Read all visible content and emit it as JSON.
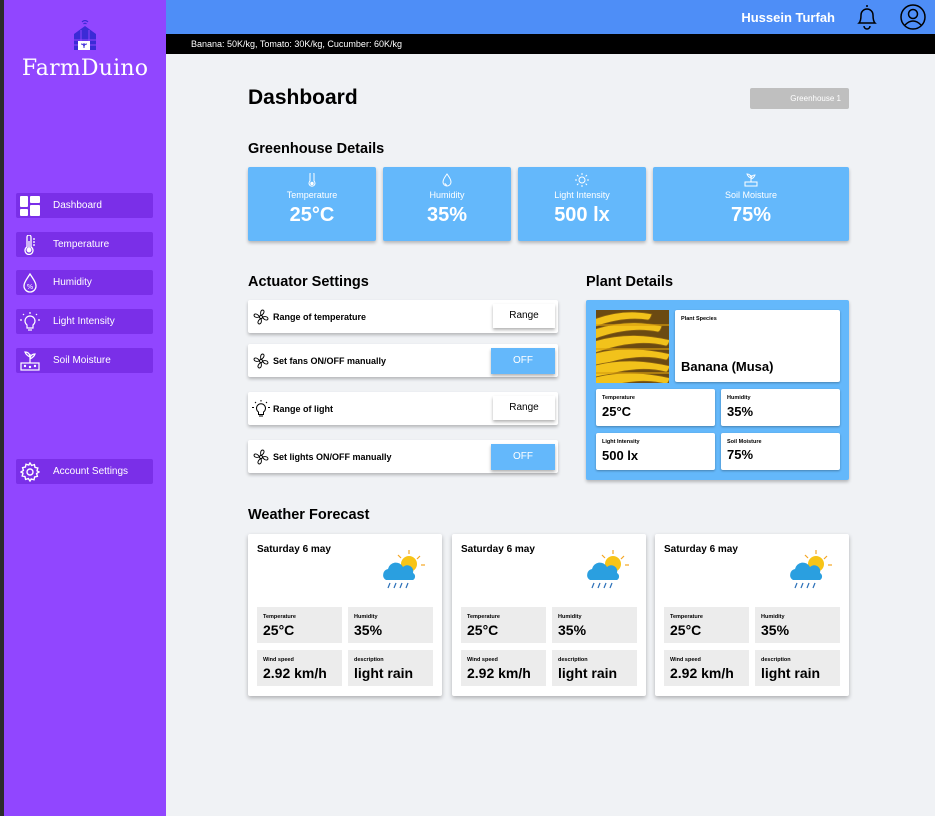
{
  "app": {
    "name": "FarmDuino"
  },
  "header": {
    "user_name": "Hussein Turfah"
  },
  "ticker": "Banana: 50K/kg, Tomato: 30K/kg, Cucumber: 60K/kg",
  "sidebar": {
    "items": [
      {
        "label": "Dashboard",
        "icon": "dashboard-icon"
      },
      {
        "label": "Temperature",
        "icon": "thermometer-icon"
      },
      {
        "label": "Humidity",
        "icon": "humidity-icon"
      },
      {
        "label": "Light Intensity",
        "icon": "lightbulb-icon"
      },
      {
        "label": "Soil Moisture",
        "icon": "soil-moisture-icon"
      }
    ],
    "account": {
      "label": "Account Settings",
      "icon": "gear-icon"
    }
  },
  "page": {
    "title": "Dashboard",
    "greenhouse_selector": "Greenhouse 1"
  },
  "greenhouse": {
    "title": "Greenhouse Details",
    "stats": [
      {
        "label": "Temperature",
        "value": "25°C",
        "icon": "thermometer-icon"
      },
      {
        "label": "Humidity",
        "value": "35%",
        "icon": "droplet-icon"
      },
      {
        "label": "Light Intensity",
        "value": "500 lx",
        "icon": "sun-icon"
      },
      {
        "label": "Soil Moisture",
        "value": "75%",
        "icon": "plant-icon"
      }
    ]
  },
  "actuators": {
    "title": "Actuator Settings",
    "rows": [
      {
        "label": "Range of temperature",
        "button": "Range",
        "icon": "fan-icon"
      },
      {
        "label": "Set fans ON/OFF manually",
        "button": "OFF",
        "icon": "fan-icon"
      },
      {
        "label": "Range of light",
        "button": "Range",
        "icon": "lightbulb-icon"
      },
      {
        "label": "Set lights ON/OFF manually",
        "button": "OFF",
        "icon": "fan-icon"
      }
    ]
  },
  "plant": {
    "title": "Plant Details",
    "species_label": "Plant Species",
    "species": "Banana (Musa)",
    "temperature_label": "Temperature",
    "temperature": "25°C",
    "humidity_label": "Humidity",
    "humidity": "35%",
    "light_label": "Light Intensity",
    "light": "500 lx",
    "soil_label": "Soil Moisture",
    "soil": "75%"
  },
  "weather": {
    "title": "Weather Forecast",
    "cards": [
      {
        "date": "Saturday 6 may",
        "temperature_label": "Temperature",
        "temperature": "25°C",
        "humidity_label": "Humidity",
        "humidity": "35%",
        "wind_label": "Wind speed",
        "wind": "2.92 km/h",
        "desc_label": "description",
        "desc": "light rain"
      },
      {
        "date": "Saturday 6 may",
        "temperature_label": "Temperature",
        "temperature": "25°C",
        "humidity_label": "Humidity",
        "humidity": "35%",
        "wind_label": "Wind speed",
        "wind": "2.92 km/h",
        "desc_label": "description",
        "desc": "light rain"
      },
      {
        "date": "Saturday 6 may",
        "temperature_label": "Temperature",
        "temperature": "25°C",
        "humidity_label": "Humidity",
        "humidity": "35%",
        "wind_label": "Wind speed",
        "wind": "2.92 km/h",
        "desc_label": "description",
        "desc": "light rain"
      }
    ]
  },
  "colors": {
    "sidebar": "#9146ff",
    "sidebar_item": "#7a2fe8",
    "topbar": "#4e8ef7",
    "card_blue": "#64b8fb"
  }
}
